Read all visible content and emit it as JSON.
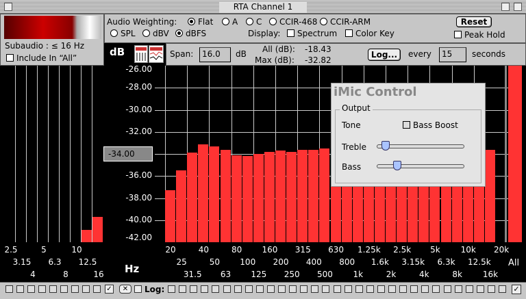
{
  "window": {
    "title": "RTA Channel 1"
  },
  "subaudio": {
    "label": "Subaudio : ≤ 16 Hz",
    "include_label": "Include In “All”"
  },
  "weighting": {
    "label": "Audio Weighting:",
    "options": [
      "Flat",
      "A",
      "C",
      "CCIR-468",
      "CCIR-ARM"
    ],
    "selected": "Flat"
  },
  "units": {
    "options": [
      "SPL",
      "dBV",
      "dBFS"
    ],
    "selected": "dBFS"
  },
  "display": {
    "label": "Display:",
    "spectrum_label": "Spectrum",
    "colorkey_label": "Color Key"
  },
  "reset_label": "Reset",
  "peak_hold_label": "Peak Hold",
  "db_label": "dB",
  "span": {
    "label": "Span:",
    "value": "16.0",
    "unit": "dB"
  },
  "stats": {
    "all_label": "All (dB):",
    "all_value": "-18.43",
    "max_label": "Max (dB):",
    "max_value": "-32.82"
  },
  "log": {
    "button_label": "Log...",
    "every_label": "every",
    "value": "15",
    "unit": "seconds"
  },
  "db_ticks": [
    "-26.00",
    "-28.00",
    "-30.00",
    "-32.00",
    "-34.00",
    "-36.00",
    "-38.00",
    "-40.00",
    "-42.00"
  ],
  "marker_value": "-34.00",
  "hz_label": "Hz",
  "all_label": "All",
  "low_freq_labels": {
    "row1": [
      "2.5",
      "5",
      "10"
    ],
    "row2": [
      "3.15",
      "6.3",
      "12.5"
    ],
    "row3": [
      "4",
      "8",
      "16"
    ]
  },
  "freq_labels": {
    "row1": [
      "20",
      "40",
      "80",
      "160",
      "315",
      "630",
      "1.25k",
      "2.5k",
      "5k",
      "10k",
      "20k"
    ],
    "row2": [
      "25",
      "50",
      "100",
      "200",
      "400",
      "800",
      "1.6k",
      "3.15k",
      "6.3k",
      "12.5k"
    ],
    "row3": [
      "31.5",
      "63",
      "125",
      "250",
      "500",
      "1k",
      "2k",
      "4k",
      "8k",
      "16k"
    ]
  },
  "bottom": {
    "log_label": "Log:"
  },
  "imic": {
    "title": "iMic Control",
    "group_label": "Output",
    "tone_label": "Tone",
    "bass_boost_label": "Bass Boost",
    "treble_label": "Treble",
    "bass_label": "Bass",
    "treble_level": 0.05,
    "bass_level": 0.2
  },
  "chart_data": {
    "type": "bar",
    "ylim": [
      -42,
      -26
    ],
    "low_values": [
      -42,
      -42,
      -42,
      -42,
      -42,
      -42,
      -42,
      -40.9,
      -39.7
    ],
    "values": [
      -37.3,
      -35.5,
      -33.9,
      -33.1,
      -33.3,
      -33.6,
      -34.1,
      -34.2,
      -34.0,
      -33.8,
      -33.7,
      -33.8,
      -33.6,
      -33.6,
      -33.5,
      -33.4,
      -33.4,
      -33.3,
      -33.2,
      -33.1,
      -33.0,
      -33.0,
      -33.1,
      -33.2,
      -33.0,
      -32.8,
      -32.9,
      -33.0,
      -33.2,
      -33.6
    ],
    "all_value": -26.0
  }
}
